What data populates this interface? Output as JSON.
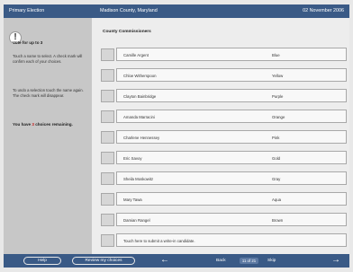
{
  "header": {
    "left": "Primary Election",
    "center": "Madison County, Maryland",
    "right": "02 November 2006"
  },
  "sidebar": {
    "icon": "exclamation-icon",
    "title": "Vote for up to 3",
    "para1": "Touch a name to select. A check mark will confirm each of your choices.",
    "para2": "To undo a selection touch the name again. The check mark will disappear.",
    "remaining_prefix": "You have ",
    "remaining_count": "3",
    "remaining_suffix": " choices remaining."
  },
  "contest": {
    "title": "County Commissioners",
    "candidates": [
      {
        "name": "Camille Argent",
        "party": "Blue"
      },
      {
        "name": "Chloe Witherspoon",
        "party": "Yellow"
      },
      {
        "name": "Clayton Bainbridge",
        "party": "Purple"
      },
      {
        "name": "Amanda Marracini",
        "party": "Orange"
      },
      {
        "name": "Charlene Hennessey",
        "party": "Pink"
      },
      {
        "name": "Eric Savoy",
        "party": "Gold"
      },
      {
        "name": "Sheila Moskowitz",
        "party": "Gray"
      },
      {
        "name": "Mary Tawa",
        "party": "Aqua"
      },
      {
        "name": "Damian Rangel",
        "party": "Brown"
      }
    ],
    "write_in": "Touch here to submit a write-in candidate."
  },
  "footer": {
    "help": "Help",
    "review": "Review my choices",
    "back": "Back",
    "page": "11 of 21",
    "skip": "Skip",
    "left_arrow": "←",
    "right_arrow": "→"
  },
  "colors": {
    "bar_blue": "#3a5a86",
    "sidebar_gray": "#c7c7c7",
    "content_gray": "#ededed",
    "accent_red": "#c42222"
  }
}
